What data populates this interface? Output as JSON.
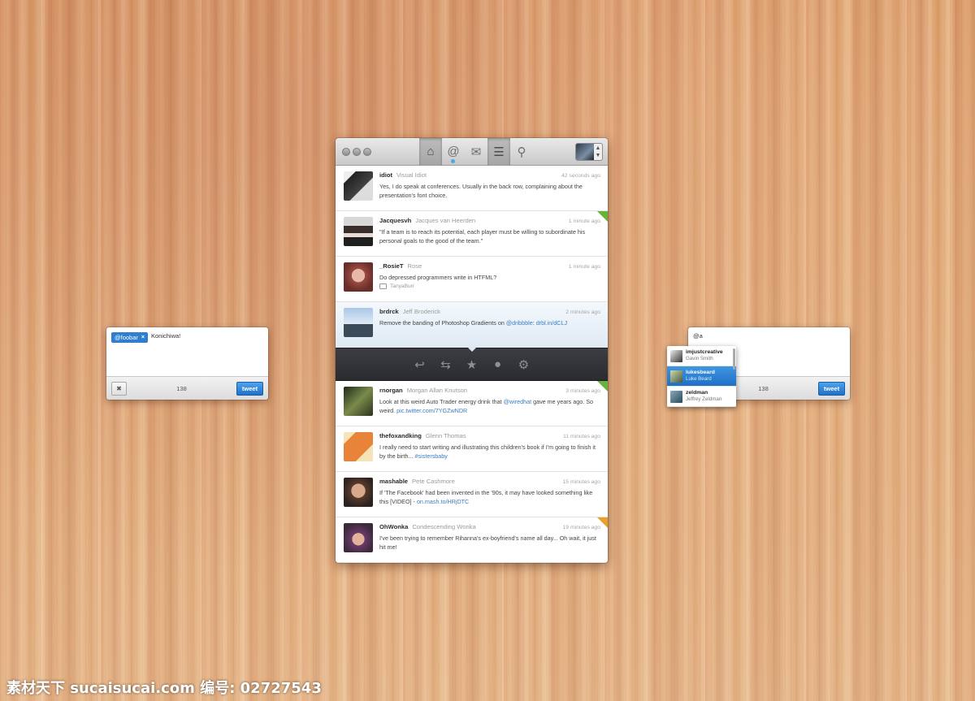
{
  "window": {
    "tabs": [
      {
        "name": "home",
        "glyph": "⌂"
      },
      {
        "name": "mentions",
        "glyph": "@"
      },
      {
        "name": "messages",
        "glyph": "✉"
      },
      {
        "name": "lists",
        "glyph": "☰"
      },
      {
        "name": "search",
        "glyph": "⚲"
      }
    ],
    "account_arrows": "▲\n▼"
  },
  "tweets": [
    {
      "user": "idiot",
      "name": "Visual Idiot",
      "time": "42 seconds ago",
      "text": "Yes, I do speak at conferences. Usually in the back row, complaining about the presentation's font choice.",
      "avatar": "#3b3b3b"
    },
    {
      "user": "Jacquesvh",
      "name": "Jacques van Heerden",
      "time": "1 minute ago",
      "text": "\"If a team is to reach its potential, each player must be willing to subordinate his personal goals to the good of the team.\"",
      "avatar": "#5a4a44",
      "corner": "green"
    },
    {
      "user": "_RosieT",
      "name": "Rose",
      "time": "1 minute ago",
      "text": "Do depressed programmers write in HTFML?",
      "retweeted_by": "TanyaBurr",
      "avatar": "#9a5a52"
    },
    {
      "user": "brdrck",
      "name": "Jeff Broderick",
      "time": "2 minutes ago",
      "text": "Remove the banding of Photoshop Gradients on ",
      "link1": "@dribbble",
      "link2": "drbl.in/dCLJ",
      "avatar": "#6d8aa6"
    }
  ],
  "action_bar": [
    {
      "name": "reply-icon",
      "glyph": "↩"
    },
    {
      "name": "retweet-icon",
      "glyph": "⇆"
    },
    {
      "name": "favorite-icon",
      "glyph": "★"
    },
    {
      "name": "profile-icon",
      "glyph": "👤"
    },
    {
      "name": "settings-icon",
      "glyph": "⚙"
    }
  ],
  "tweets2": [
    {
      "user": "rnorgan",
      "name": "Morgan Allan Knutson",
      "time": "3 minutes ago",
      "text": "Look at this weird Auto Trader energy drink that ",
      "link1": "@wiredhat",
      "text2": " gave me years ago. So weird. ",
      "link2": "pic.twitter.com/7YGZwNDR",
      "avatar": "#4d5a3a",
      "corner": "green"
    },
    {
      "user": "thefoxandking",
      "name": "Glenn Thomas",
      "time": "11 minutes ago",
      "text": "I really need to start writing and illustrating this children's book if I'm going to finish it by the birth... ",
      "link1": "#sistersbaby",
      "avatar": "#e8833a"
    },
    {
      "user": "mashable",
      "name": "Pete Cashmore",
      "time": "15 minutes ago",
      "text": "If 'The Facebook' had been invented in the '90s, it may have looked something like this [VIDEO] - ",
      "link1": "on.mash.to/HRjDTC",
      "avatar": "#8a6a58"
    },
    {
      "user": "OhWonka",
      "name": "Condescending Wonka",
      "time": "19 minutes ago",
      "text": "I've been trying to remember Rihanna's ex-boyfriend's name all day... Oh wait, it just hit me!",
      "avatar": "#7a5a70",
      "corner": "orange"
    }
  ],
  "compose_left": {
    "token": "@foobar",
    "text": "Konichiwa!",
    "count": "138",
    "clear": "✖",
    "tweet": "tweet"
  },
  "compose_right": {
    "text": "@a",
    "count": "138",
    "tweet": "tweet"
  },
  "autocomplete": [
    {
      "user": "imjustcreative",
      "name": "Gavin Smith",
      "color": "#444"
    },
    {
      "user": "lukesbeard",
      "name": "Luke Beard",
      "color": "#7a8a5a"
    },
    {
      "user": "zeldman",
      "name": "Jeffrey Zeldman",
      "color": "#5a7a8a"
    }
  ],
  "watermark": "素材天下 sucaisucai.com   编号: 02727543"
}
